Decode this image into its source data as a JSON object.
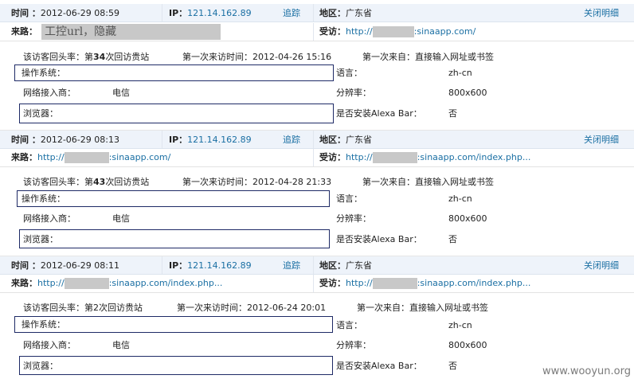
{
  "labels": {
    "time": "时间",
    "ip": "IP",
    "track": "追踪",
    "region": "地区",
    "close_detail": "关闭明细",
    "source": "来路",
    "visited": "受访",
    "return_rate_prefix": "该访客回头率：第",
    "return_rate_suffix": "次回访贵站",
    "first_visit_time": "第一次来访时间：",
    "first_from": "第一次来自：",
    "os": "操作系统：",
    "language": "语言：",
    "isp": "网络接入商：",
    "resolution": "分辨率：",
    "browser": "浏览器：",
    "alexa": "是否安装Alexa Bar："
  },
  "records": [
    {
      "time": "2012-06-29 08:59",
      "ip": "121.14.162.89",
      "region": "广东省",
      "source_text": "工控url，隐藏",
      "visited_prefix": "http://",
      "visited_suffix": ":sinaapp.com/",
      "return_count": "34",
      "return_bold": true,
      "first_visit_time": "2012-04-26 15:16",
      "first_from": "直接输入网址或书签",
      "language": "zh-cn",
      "isp": "电信",
      "resolution": "800x600",
      "alexa": "否"
    },
    {
      "time": "2012-06-29 08:13",
      "ip": "121.14.162.89",
      "region": "广东省",
      "source_prefix": "http://",
      "source_suffix": ":sinaapp.com/",
      "visited_prefix": "http://",
      "visited_suffix": ":sinaapp.com/index.php...",
      "return_count": "43",
      "return_bold": true,
      "first_visit_time": "2012-04-28 21:33",
      "first_from": "直接输入网址或书签",
      "language": "zh-cn",
      "isp": "电信",
      "resolution": "800x600",
      "alexa": "否"
    },
    {
      "time": "2012-06-29 08:11",
      "ip": "121.14.162.89",
      "region": "广东省",
      "source_prefix": "http://",
      "source_suffix": ":sinaapp.com/index.php...",
      "visited_prefix": "http://",
      "visited_suffix": ":sinaapp.com/index.php...",
      "return_count": "2",
      "return_bold": false,
      "first_visit_time": "2012-06-24 20:01",
      "first_from": "直接输入网址或书签",
      "language": "zh-cn",
      "isp": "电信",
      "resolution": "800x600",
      "alexa": "否"
    }
  ],
  "watermark": "www.wooyun.org"
}
